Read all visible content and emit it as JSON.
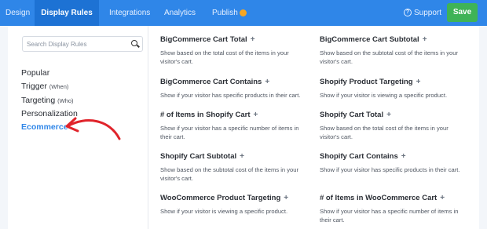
{
  "nav": {
    "tabs": [
      {
        "label": "Design"
      },
      {
        "label": "Display Rules"
      },
      {
        "label": "Integrations"
      },
      {
        "label": "Analytics"
      },
      {
        "label": "Publish"
      }
    ],
    "support_label": "Support",
    "save_label": "Save"
  },
  "sidebar": {
    "search_placeholder": "Search Display Rules",
    "categories": [
      {
        "label": "Popular",
        "sub": ""
      },
      {
        "label": "Trigger",
        "sub": "(When)"
      },
      {
        "label": "Targeting",
        "sub": "(Who)"
      },
      {
        "label": "Personalization",
        "sub": ""
      },
      {
        "label": "Ecommerce",
        "sub": ""
      }
    ]
  },
  "rules": [
    {
      "title": "BigCommerce Cart Total",
      "desc": "Show based on the total cost of the items in your visitor's cart."
    },
    {
      "title": "BigCommerce Cart Subtotal",
      "desc": "Show based on the subtotal cost of the items in your visitor's cart."
    },
    {
      "title": "BigCommerce Cart Contains",
      "desc": "Show if your visitor has specific products in their cart."
    },
    {
      "title": "Shopify Product Targeting",
      "desc": "Show if your visitor is viewing a specific product."
    },
    {
      "title": "# of Items in Shopify Cart",
      "desc": "Show if your visitor has a specific number of items in their cart."
    },
    {
      "title": "Shopify Cart Total",
      "desc": "Show based on the total cost of the items in your visitor's cart."
    },
    {
      "title": "Shopify Cart Subtotal",
      "desc": "Show based on the subtotal cost of the items in your visitor's cart."
    },
    {
      "title": "Shopify Cart Contains",
      "desc": "Show if your visitor has specific products in their cart."
    },
    {
      "title": "WooCommerce Product Targeting",
      "desc": "Show if your visitor is viewing a specific product."
    },
    {
      "title": "# of Items in WooCommerce Cart",
      "desc": "Show if your visitor has a specific number of items in their cart."
    }
  ],
  "colors": {
    "accent": "#2f86e8",
    "active_tab": "#1d72d4",
    "save": "#3fb356",
    "annotation_arrow": "#e0242b",
    "publish_dot": "#f6a623"
  }
}
